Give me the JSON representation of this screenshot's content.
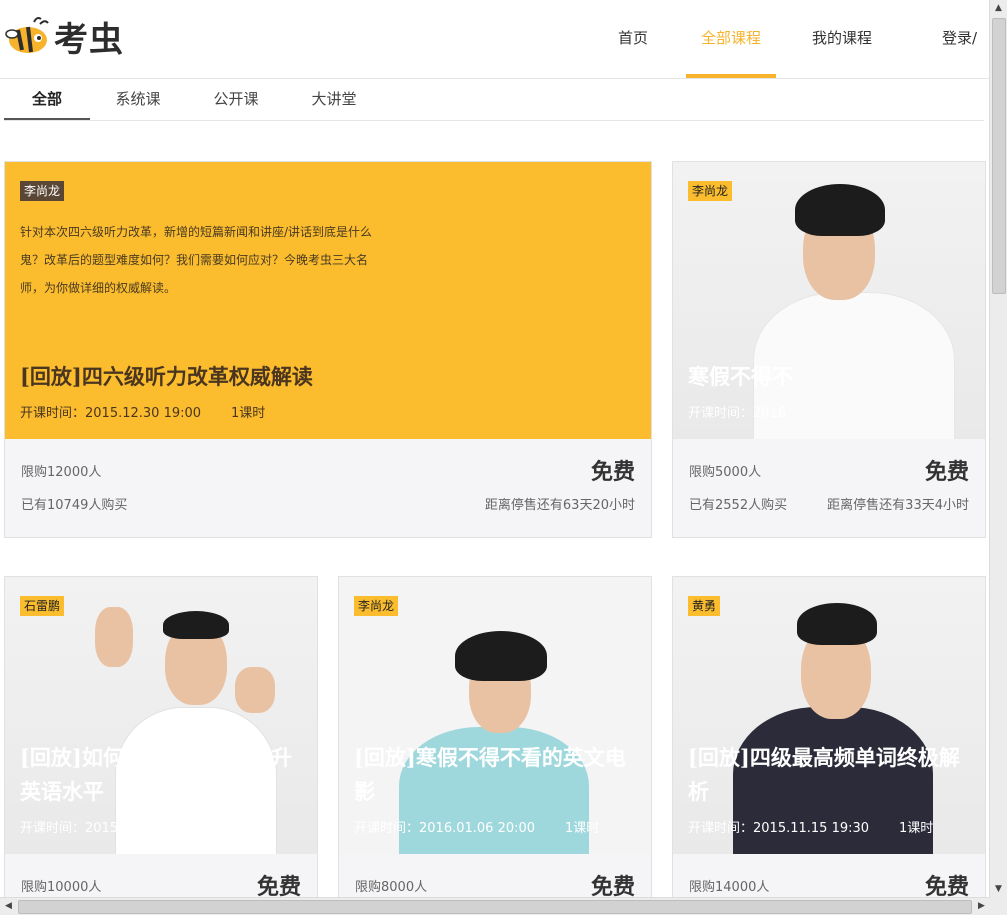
{
  "header": {
    "logo_text": "考虫",
    "nav": [
      {
        "label": "首页"
      },
      {
        "label": "全部课程"
      },
      {
        "label": "我的课程"
      },
      {
        "label": "登录/注"
      }
    ],
    "active_color": "#f7b32b"
  },
  "subtabs": [
    {
      "label": "全部"
    },
    {
      "label": "系统课"
    },
    {
      "label": "公开课"
    },
    {
      "label": "大讲堂"
    }
  ],
  "cards": [
    {
      "teacher": "李尚龙",
      "desc": "针对本次四六级听力改革，新增的短篇新闻和讲座/讲话到底是什么鬼？改革后的题型难度如何？我们需要如何应对？今晚考虫三大名师，为你做详细的权威解读。",
      "title": "[回放]四六级听力改革权威解读",
      "time": "开课时间：2015.12.30 19:00",
      "lessons": "1课时",
      "limit": "限购12000人",
      "sold": "已有10749人购买",
      "price": "免费",
      "countdown": "距离停售还有63天20小时"
    },
    {
      "teacher": "李尚龙",
      "title": "寒假不得不",
      "time": "开课时间：2016",
      "limit": "限购5000人",
      "sold": "已有2552人购买",
      "price": "免费",
      "countdown": "距离停售还有33天4小时"
    },
    {
      "teacher": "石雷鹏",
      "title": "[回放]如何利用寒假快速提升英语水平",
      "time": "开课时间：2015.12.29 20:00",
      "lessons": "1课时",
      "limit": "限购10000人",
      "price": "免费"
    },
    {
      "teacher": "李尚龙",
      "title": "[回放]寒假不得不看的英文电影",
      "time": "开课时间：2016.01.06 20:00",
      "lessons": "1课时",
      "limit": "限购8000人",
      "price": "免费"
    },
    {
      "teacher": "黄勇",
      "title": "[回放]四级最高频单词终极解析",
      "time": "开课时间：2015.11.15 19:30",
      "lessons": "1课时",
      "limit": "限购14000人",
      "price": "免费"
    }
  ]
}
